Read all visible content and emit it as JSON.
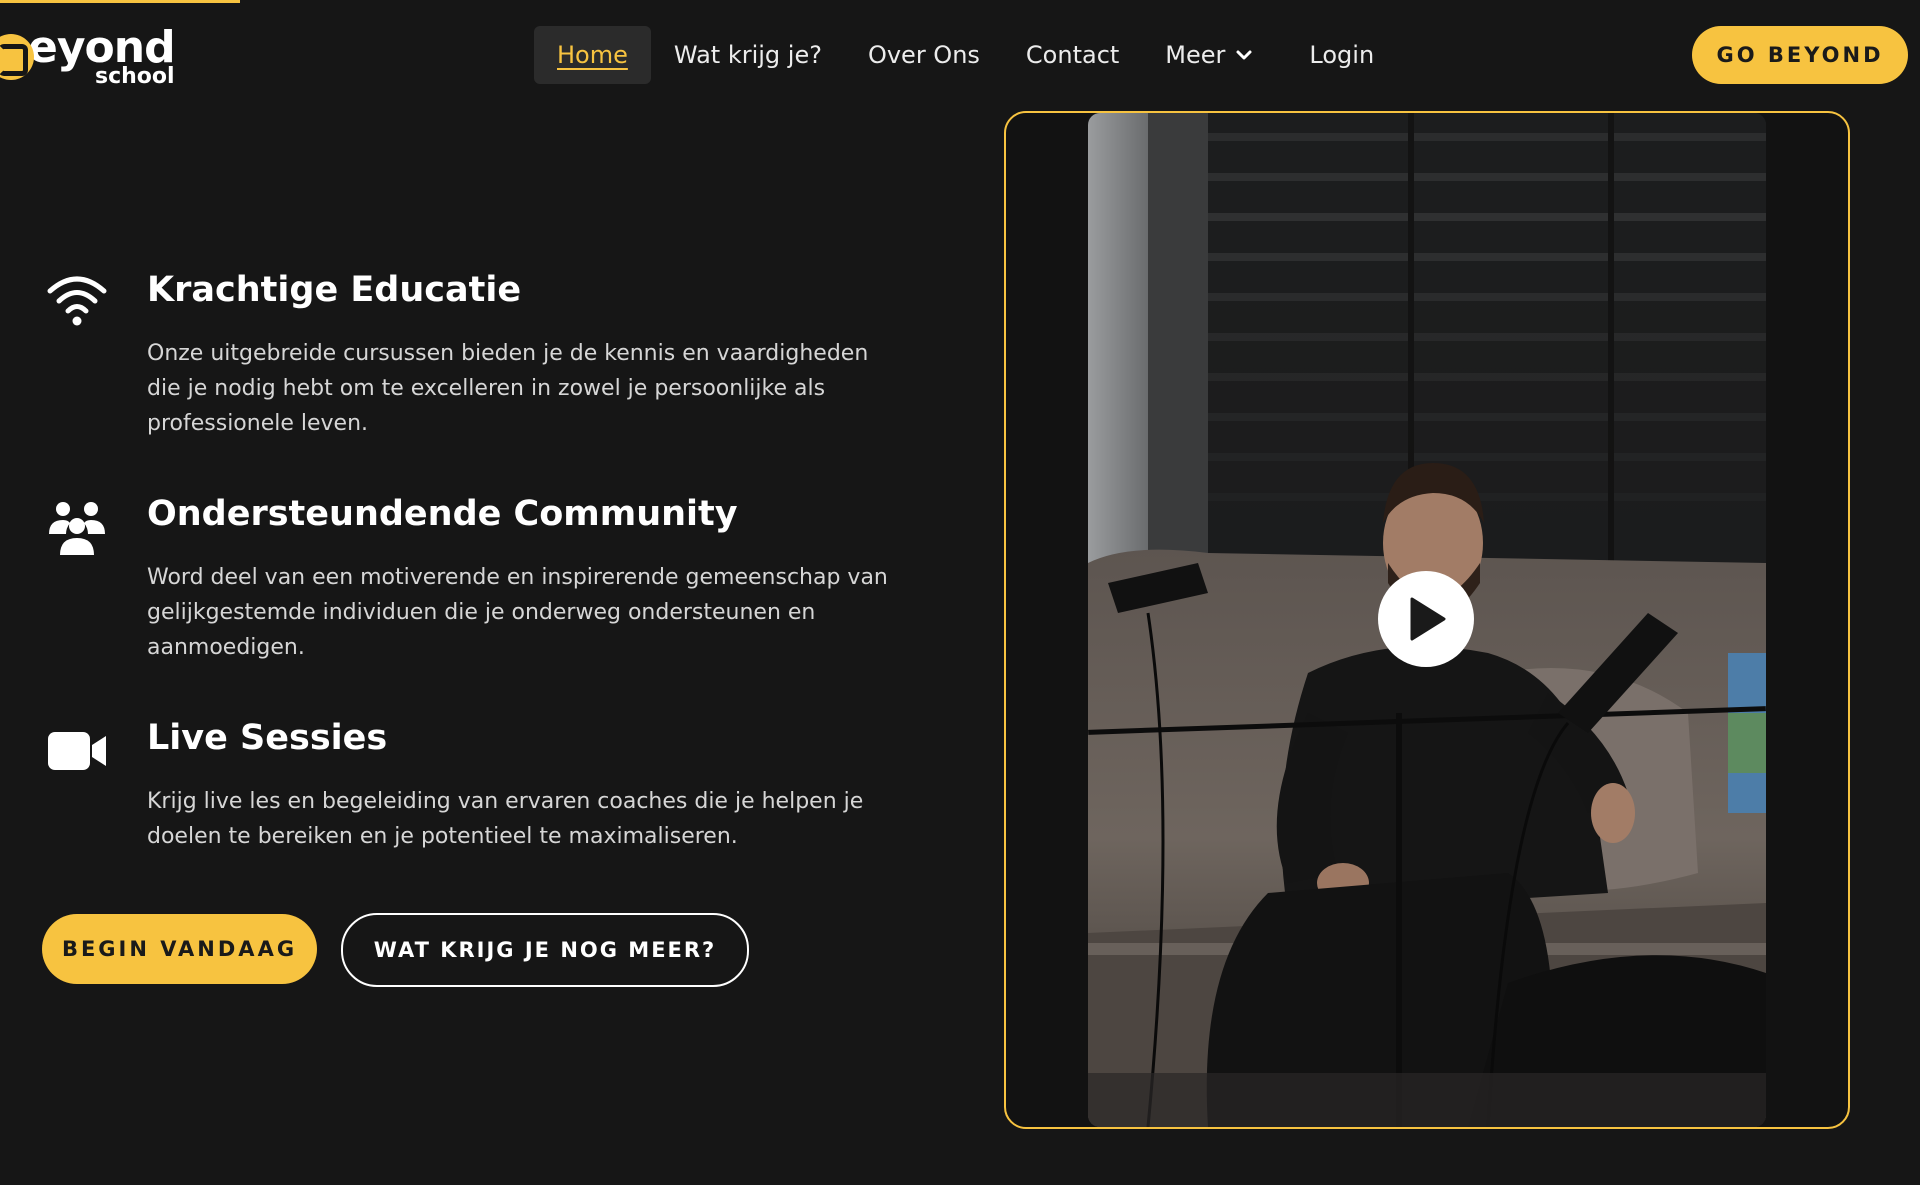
{
  "header": {
    "logo": {
      "main": "eyond",
      "sub": "school"
    },
    "nav": [
      {
        "label": "Home",
        "active": true
      },
      {
        "label": "Wat krijg je?"
      },
      {
        "label": "Over Ons"
      },
      {
        "label": "Contact"
      },
      {
        "label": "Meer",
        "icon": "chevron-down-icon"
      },
      {
        "label": "Login"
      }
    ],
    "cta_label": "GO BEYOND"
  },
  "features": [
    {
      "icon": "wifi-icon",
      "title": "Krachtige Educatie",
      "description": "Onze uitgebreide cursussen bieden je de kennis en vaardigheden die je nodig hebt om te excelleren in zowel je persoonlijke als professionele leven."
    },
    {
      "icon": "users-icon",
      "title": "Ondersteundende Community",
      "description": "Word deel van een motiverende en inspirerende gemeenschap van gelijkgestemde individuen die je onderweg ondersteunen en aanmoedigen."
    },
    {
      "icon": "video-camera-icon",
      "title": "Live Sessies",
      "description": "Krijg live les en begeleiding van ervaren coaches die je helpen je doelen te bereiken en je potentieel te maximaliseren."
    }
  ],
  "buttons": {
    "primary": "BEGIN VANDAAG",
    "secondary": "WAT KRIJG JE NOG MEER?"
  },
  "video": {
    "play_icon": "play-icon"
  },
  "colors": {
    "accent": "#f7c340",
    "background": "#161616",
    "text": "#ffffff"
  }
}
